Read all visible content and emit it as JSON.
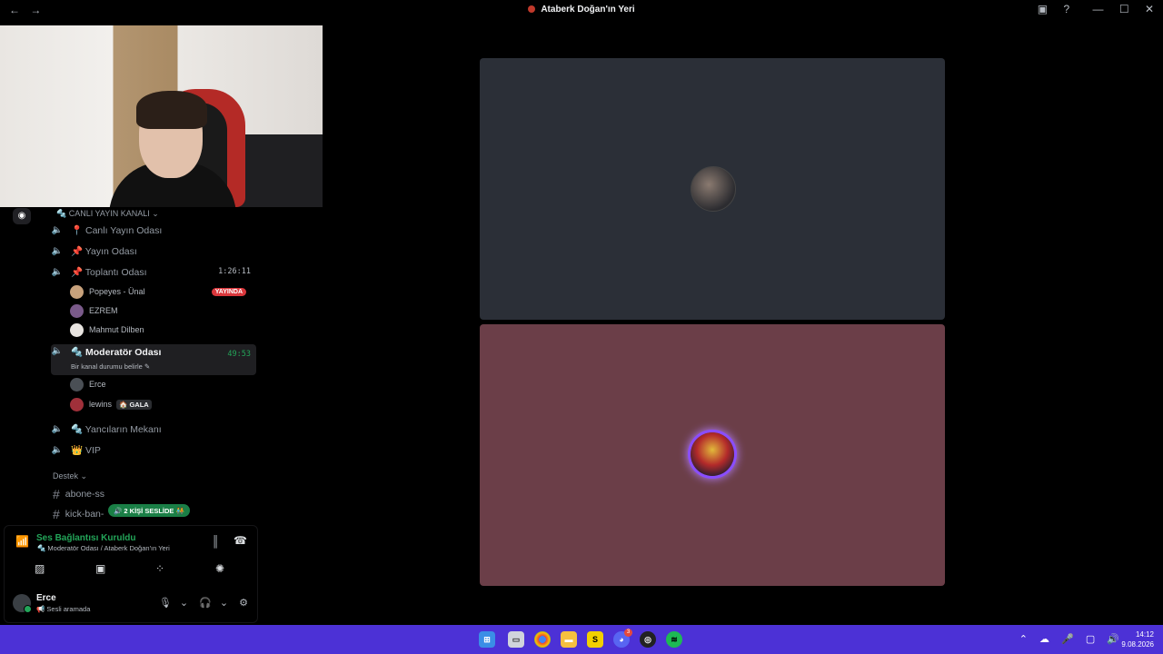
{
  "window": {
    "title": "Ataberk Doğan'ın Yeri",
    "back_glyph": "←",
    "forward_glyph": "→",
    "inbox_icon": "▣",
    "help_icon": "?",
    "minimize_glyph": "—",
    "maximize_glyph": "☐",
    "close_glyph": "✕"
  },
  "sidebar": {
    "category_live": "🔩 CANLI YAYIN KANALI ⌄",
    "voice_channels": [
      {
        "label": "📍 Canlı Yayın Odası"
      },
      {
        "label": "📌 Yayın Odası"
      },
      {
        "label": "📌 Toplantı Odası",
        "time": "1:26:11"
      },
      {
        "label": "🔩 Moderatör Odası",
        "time": "49:53",
        "status": "Bir kanal durumu belirle ✎"
      },
      {
        "label": "🔩 Yancıların Mekanı"
      },
      {
        "label": "👑 VIP"
      }
    ],
    "meeting_users": [
      {
        "name": "Popeyes - Ünal",
        "badge": "YAYINDA"
      },
      {
        "name": "EZREM"
      },
      {
        "name": "Mahmut Dilben"
      }
    ],
    "mod_users": [
      {
        "name": "Erce"
      },
      {
        "name": "lewins",
        "tag": "🏠 GALA"
      }
    ],
    "category_support": "Destek ⌄",
    "text_channels": [
      {
        "label": "abone-ss"
      },
      {
        "label": "kick-ban-"
      }
    ],
    "voice_pill": "🔊 2 KİŞİ SESLİDE 🧑‍🤝‍🧑"
  },
  "voice_panel": {
    "title": "Ses Bağlantısı Kuruldu",
    "subtitle": "🔩 Moderatör Odası / Ataberk Doğan'ın Yeri"
  },
  "user_panel": {
    "name": "Erce",
    "status": "📢 Sesli aramada"
  },
  "taskbar": {
    "time": "14:12",
    "date": "9.08.2026",
    "discord_badge": "3"
  },
  "colors": {
    "tile_top": "#2b2f37",
    "tile_bottom": "#6b3e48",
    "taskbar": "#4c31d6",
    "connected_green": "#23a559",
    "live_red": "#da373c"
  }
}
